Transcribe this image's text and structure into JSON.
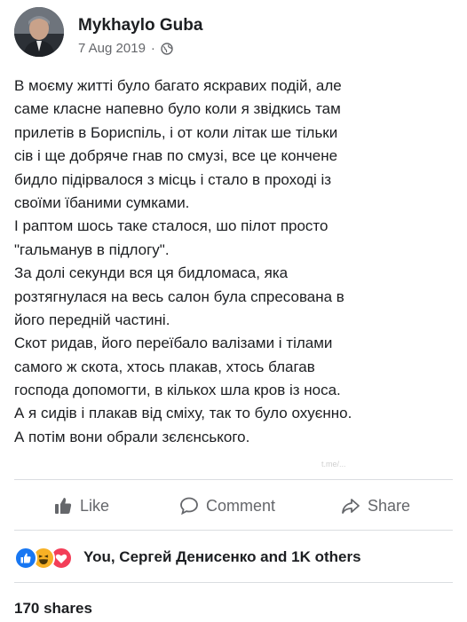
{
  "post": {
    "author": "Mykhaylo Guba",
    "date": "7 Aug 2019",
    "separator": "·",
    "privacy_icon": "globe-icon",
    "lines": [
      "В моєму житті було багато яскравих подій, але",
      "саме класне напевно було коли я звідкись там",
      "прилетів в Бориспіль, і от коли літак ше тільки",
      "сів і ще добряче гнав по смузі, все це кончене",
      "бидло підірвалося з місць і стало в проході із",
      "своїми їбаними сумками.",
      "І раптом шось таке сталося, шо пілот просто",
      "\"гальманув в підлогу\".",
      "За долі секунди вся ця бидломаса, яка",
      "розтягнулася на весь салон була спресована в",
      "його передній частині.",
      "Скот ридав, його переїбало валізами і тілами",
      "самого ж скота, хтось плакав, хтось благав",
      "господа допомогти, в кількох шла кров із носа.",
      "А я сидів і плакав від сміху, так то було охуєнно.",
      "А потім вони обрали зєлєнського."
    ],
    "watermark": "t.me/..."
  },
  "actions": {
    "like_label": "Like",
    "comment_label": "Comment",
    "share_label": "Share"
  },
  "reactions": {
    "icons": [
      "like-icon",
      "haha-icon",
      "love-icon"
    ],
    "summary": "You, Сергей Денисенко and 1K others"
  },
  "shares": {
    "text": "170 shares"
  },
  "colors": {
    "like_blue": "#1877f2",
    "haha_yellow": "#f7b125",
    "love_red": "#f33e58",
    "secondary_text": "#65676b",
    "divider": "#dadde1"
  }
}
